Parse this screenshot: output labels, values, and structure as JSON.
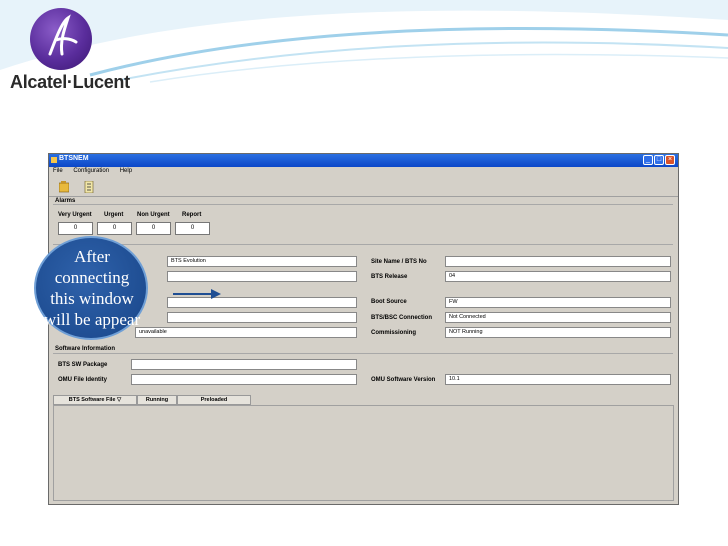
{
  "brand": {
    "name": "Alcatel·Lucent"
  },
  "window": {
    "title": "BTSNEM",
    "menu": [
      "File",
      "Configuration",
      "Help"
    ]
  },
  "alarms": {
    "section": "Alarms",
    "headers": [
      "Very Urgent",
      "Urgent",
      "Non Urgent",
      "Report"
    ],
    "values": [
      "0",
      "0",
      "0",
      "0"
    ]
  },
  "fields": {
    "bts_type_value": "BTS Evolution",
    "site_name_label": "Site Name / BTS No",
    "site_name_value": "",
    "bts_release_label": "BTS Release",
    "bts_release_value": "04",
    "boot_source_label": "Boot Source",
    "boot_source_value": "FW",
    "btsbsc_label": "BTS/BSC Connection",
    "btsbsc_value": "Not Connected",
    "commissioning_label": "Commissioning",
    "commissioning_value": "NOT Running",
    "unavailable_value": "unavailable"
  },
  "software": {
    "section": "Software Information",
    "bts_sw_package_label": "BTS SW Package",
    "omu_file_identity_label": "OMU File Identity",
    "omu_sw_version_label": "OMU Software Version",
    "omu_sw_version_value": "10.1"
  },
  "table": {
    "headers": [
      "BTS Software File ▽",
      "Running",
      "Preloaded"
    ]
  },
  "callout": {
    "text_lines": [
      "After",
      "connecting",
      "this window",
      "will be appear"
    ]
  },
  "colors": {
    "titlebar": "#0b46c8",
    "callout": "#1f4e93",
    "window_bg": "#d4d0c8"
  }
}
